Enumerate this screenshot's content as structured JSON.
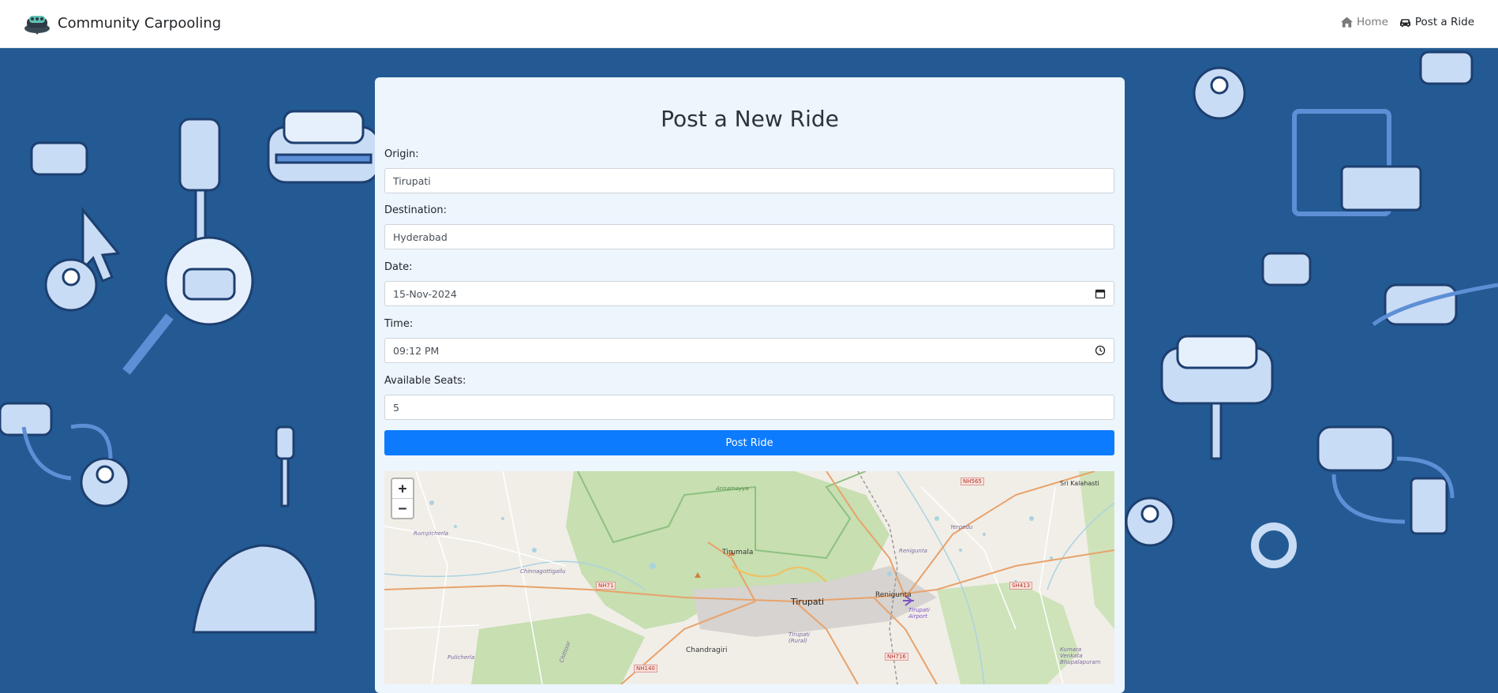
{
  "navbar": {
    "brand": "Community Carpooling",
    "links": [
      {
        "label": "Home",
        "icon": "home-icon",
        "active": false
      },
      {
        "label": "Post a Ride",
        "icon": "car-icon",
        "active": true
      }
    ]
  },
  "form": {
    "title": "Post a New Ride",
    "fields": {
      "origin": {
        "label": "Origin:",
        "value": "Tirupati"
      },
      "destination": {
        "label": "Destination:",
        "value": "Hyderabad"
      },
      "date": {
        "label": "Date:",
        "value": "15-Nov-2024"
      },
      "time": {
        "label": "Time:",
        "value": "09:12 PM"
      },
      "seats": {
        "label": "Available Seats:",
        "value": "5"
      }
    },
    "submit_label": "Post Ride"
  },
  "map": {
    "zoom_in": "+",
    "zoom_out": "−",
    "places": {
      "tirumala": "Tirumala",
      "tirupati": "Tirupati",
      "renigunta": "Renigunta",
      "renigunta_small": "Renigunta",
      "tirupati_airport": "Tirupati Airport",
      "chandragiri": "Chandragiri",
      "sri_kalahasti": "Sri Kalahasti",
      "rompicherla": "Rompicherla",
      "chinnagottigallu": "Chinnagottigallu",
      "pulicherla": "Pulicherla",
      "kumara_venkata": "Kumara Venkata Bhupalapuram",
      "yerpedu": "Yerpedu",
      "annamayya": "Annamayya",
      "tirupati_rural": "Tirupati (Rural)",
      "chittoor": "Chittoor"
    },
    "roads": {
      "nh71": "NH71",
      "nh140": "NH140",
      "nh716": "NH716",
      "nh565": "NH565",
      "sh413": "SH413"
    }
  },
  "colors": {
    "navbar_bg": "#ffffff",
    "page_bg": "#235a93",
    "card_bg": "#edf5fd",
    "primary": "#0d7bfe"
  }
}
